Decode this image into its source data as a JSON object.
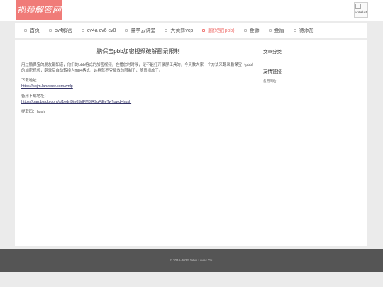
{
  "header": {
    "logo_text": "视频解密网",
    "avatar_alt": "avatar"
  },
  "nav": {
    "items": [
      {
        "label": "首页",
        "active": false
      },
      {
        "label": "cv4解密",
        "active": false
      },
      {
        "label": "cv4a cv6 cv8",
        "active": false
      },
      {
        "label": "量学云讲堂",
        "active": false
      },
      {
        "label": "大黄蜂vcp",
        "active": false
      },
      {
        "label": "鹏保宝(pbb)",
        "active": true
      },
      {
        "label": "金狮",
        "active": false
      },
      {
        "label": "金盾",
        "active": false
      },
      {
        "label": "待添加",
        "active": false
      }
    ]
  },
  "article": {
    "title": "鹏保宝pbb加密视频破解翻录限制",
    "intro": "用过鹏保宝的朋友都知道，他们的pbb格式的加密视频，在播放时时候，是不能打开录屏工具的，今天教大家一个方法来翻录鹏保宝（pbb）的加密视频，翻录后自动转换为mp4格式，这样就不受播放的限制了，随意播放了。",
    "download_label": "下载地址：",
    "download_link": "https://spjm.lanzouw.com/wnlp",
    "backup_label": "备用下载地址：",
    "backup_link": "https://pan.baidu.com/s/1ednDin0SdFM8IR9qFtEeTw?pwd=hpsh",
    "code_text": "提取码：hpsh"
  },
  "sidebar": {
    "categories_title": "文章分类",
    "links_title": "友情链接",
    "links": [
      "备用网站"
    ]
  },
  "footer": {
    "copyright": "© 2016-2022 Jehin Loves You"
  },
  "colors": {
    "accent": "#f07b78",
    "background": "#ebebeb",
    "footer": "#555555"
  }
}
